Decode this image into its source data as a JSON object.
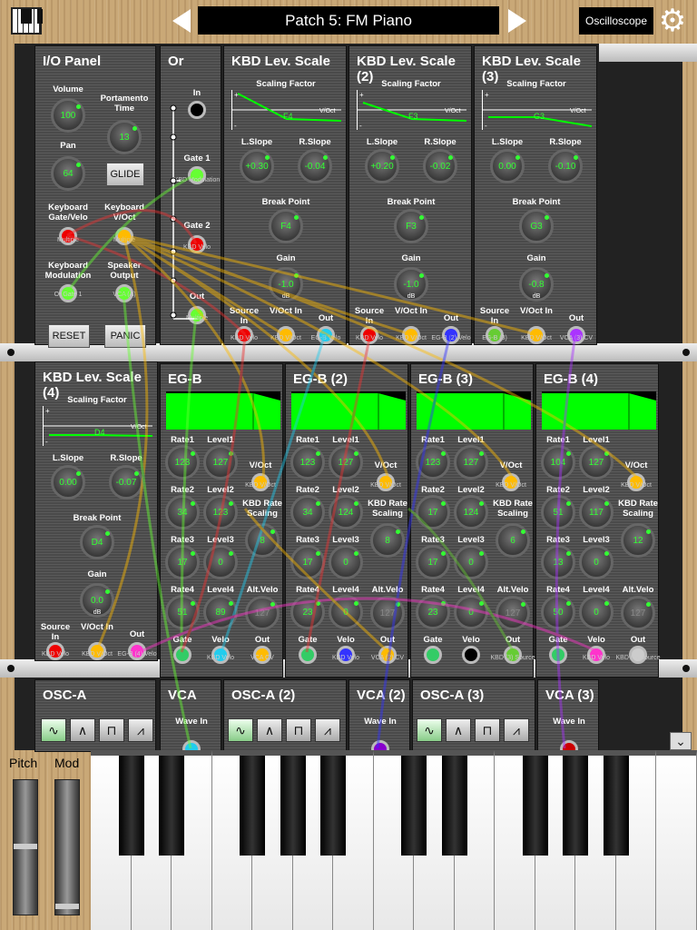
{
  "header": {
    "patch_name": "Patch 5: FM Piano",
    "oscilloscope": "Oscilloscope"
  },
  "io": {
    "title": "I/O Panel",
    "volume": "Volume",
    "volume_val": "100",
    "portamento": "Portamento Time",
    "portamento_val": "13",
    "pan": "Pan",
    "pan_val": "64",
    "glide": "GLIDE",
    "kbd_gate": "Keyboard Gate/Velo",
    "kbd_voct": "Keyboard V/Oct",
    "kbd_mod": "Keyboard Modulation",
    "spk_out": "Speaker Output",
    "multiple1": "Multiple",
    "multiple2": "Multiple",
    "or_gate": "Or Gate 1",
    "vca_a": "VCA (A)",
    "reset": "RESET",
    "panic": "PANIC"
  },
  "or": {
    "title": "Or",
    "in": "In",
    "gate1": "Gate 1",
    "gate2": "Gate 2",
    "out": "Out",
    "kbd_velo": "KBD Velo",
    "multiple": "Multiple",
    "kbd_modulation": "KBD Modulation"
  },
  "kbd1": {
    "title": "KBD Lev. Scale",
    "scaling": "Scaling Factor",
    "note": "F4",
    "voct": "V/Oct",
    "lslope": "L.Slope",
    "lslope_val": "+0.30",
    "rslope": "R.Slope",
    "rslope_val": "-0.04",
    "bp": "Break Point",
    "bp_val": "F4",
    "gain": "Gain",
    "gain_val": "-1.0",
    "db": "dB",
    "src": "Source In",
    "voctin": "V/Oct In",
    "out": "Out",
    "s1": "KBD Velo",
    "s2": "KBD V/Oct",
    "s3": "EG-B Velo"
  },
  "kbd2": {
    "title": "KBD Lev. Scale (2)",
    "scaling": "Scaling Factor",
    "note": "F3",
    "voct": "V/Oct",
    "lslope": "L.Slope",
    "lslope_val": "+0.20",
    "rslope": "R.Slope",
    "rslope_val": "-0.02",
    "bp": "Break Point",
    "bp_val": "F3",
    "gain": "Gain",
    "gain_val": "-1.0",
    "db": "dB",
    "src": "Source In",
    "voctin": "V/Oct In",
    "out": "Out",
    "s1": "KBD Velo",
    "s2": "KBD V/Oct",
    "s3": "EG-B (2) Velo"
  },
  "kbd3": {
    "title": "KBD Lev. Scale (3)",
    "scaling": "Scaling Factor",
    "note": "G3",
    "voct": "V/Oct",
    "lslope": "L.Slope",
    "lslope_val": "0.00",
    "rslope": "R.Slope",
    "rslope_val": "-0.10",
    "bp": "Break Point",
    "bp_val": "G3",
    "gain": "Gain",
    "gain_val": "-0.8",
    "db": "dB",
    "src": "Source In",
    "voctin": "V/Oct In",
    "out": "Out",
    "s1": "EG-B (3)",
    "s2": "KBD V/Oct",
    "s3": "VCA (3) CV"
  },
  "kbd4": {
    "title": "KBD Lev. Scale (4)",
    "scaling": "Scaling Factor",
    "note": "D4",
    "voct": "V/Oct",
    "lslope": "L.Slope",
    "lslope_val": "0.00",
    "rslope": "R.Slope",
    "rslope_val": "-0.07",
    "bp": "Break Point",
    "bp_val": "D4",
    "gain": "Gain",
    "gain_val": "0.0",
    "db": "dB",
    "src": "Source In",
    "voctin": "V/Oct In",
    "out": "Out",
    "s1": "KBD Velo",
    "s2": "KBD V/Oct",
    "s3": "EG-B (4) Velo"
  },
  "eg": [
    {
      "title": "EG-B",
      "r1": "123",
      "l1": "127",
      "r2": "34",
      "l2": "123",
      "r3": "17",
      "l3": "0",
      "r4": "51",
      "l4": "89",
      "krs": "8",
      "av": "127",
      "s1": "KBD V/Oct",
      "s2": "KBD Velo",
      "s3": "VCA CV"
    },
    {
      "title": "EG-B (2)",
      "r1": "123",
      "l1": "127",
      "r2": "34",
      "l2": "124",
      "r3": "17",
      "l3": "0",
      "r4": "23",
      "l4": "0",
      "krs": "8",
      "av": "127",
      "s1": "KBD V/Oct",
      "s2": "KBD Velo",
      "s3": "VCA (2) CV"
    },
    {
      "title": "EG-B (3)",
      "r1": "123",
      "l1": "127",
      "r2": "17",
      "l2": "124",
      "r3": "17",
      "l3": "0",
      "r4": "23",
      "l4": "0",
      "krs": "6",
      "av": "127",
      "s1": "KBD V/Oct",
      "s2": "",
      "s3": "KBD (3) Source"
    },
    {
      "title": "EG-B (4)",
      "r1": "104",
      "l1": "127",
      "r2": "51",
      "l2": "117",
      "r3": "13",
      "l3": "0",
      "r4": "50",
      "l4": "0",
      "krs": "12",
      "av": "127",
      "s1": "KBD V/Oct",
      "s2": "KBD Velo",
      "s3": "KBD (4) Source"
    }
  ],
  "eg_labels": {
    "rate1": "Rate1",
    "level1": "Level1",
    "rate2": "Rate2",
    "level2": "Level2",
    "rate3": "Rate3",
    "level3": "Level3",
    "rate4": "Rate4",
    "level4": "Level4",
    "voct": "V/Oct",
    "krs": "KBD Rate Scaling",
    "altvelo": "Alt.Velo",
    "gate": "Gate",
    "velo": "Velo",
    "out": "Out"
  },
  "bottom": {
    "osc_a": "OSC-A",
    "vca": "VCA",
    "osc_a2": "OSC-A (2)",
    "vca2": "VCA (2)",
    "osc_a3": "OSC-A (3)",
    "vca3": "VCA (3)",
    "wave_in": "Wave In"
  },
  "wheels": {
    "pitch": "Pitch",
    "mod": "Mod"
  },
  "colors": {
    "led": "#33ff33",
    "env": "#00ff00"
  }
}
